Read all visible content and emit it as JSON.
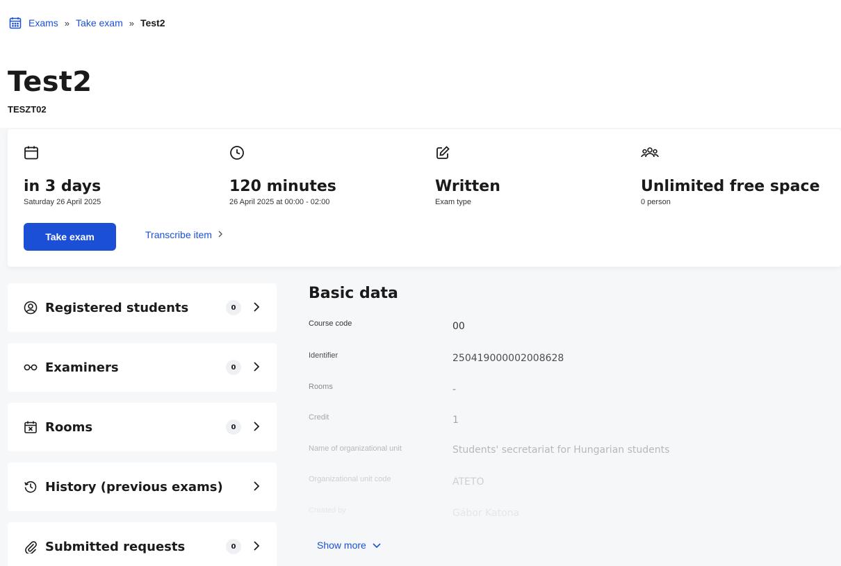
{
  "breadcrumb": {
    "items": [
      "Exams",
      "Take exam"
    ],
    "separator": "»",
    "current": "Test2"
  },
  "exam": {
    "title": "Test2",
    "code": "TESZT02"
  },
  "summary": {
    "date": {
      "icon": "calendar-icon",
      "value": "in 3 days",
      "sub": "Saturday 26 April 2025"
    },
    "duration": {
      "icon": "clock-icon",
      "value": "120 minutes",
      "sub": "26 April 2025 at 00:00 - 02:00"
    },
    "type": {
      "icon": "edit-icon",
      "value": "Written",
      "sub": "Exam type"
    },
    "space": {
      "icon": "group-icon",
      "value": "Unlimited free space",
      "sub": "0 person"
    },
    "take_exam_label": "Take exam",
    "transcribe_label": "Transcribe item"
  },
  "sidebar": {
    "items": [
      {
        "icon": "user-circle-icon",
        "label": "Registered students",
        "count": "0"
      },
      {
        "icon": "glasses-icon",
        "label": "Examiners",
        "count": "0"
      },
      {
        "icon": "room-icon",
        "label": "Rooms",
        "count": "0"
      },
      {
        "icon": "history-icon",
        "label": "History (previous exams)",
        "count": ""
      },
      {
        "icon": "paperclip-icon",
        "label": "Submitted requests",
        "count": "0"
      }
    ]
  },
  "basic_data": {
    "title": "Basic data",
    "fields": [
      {
        "label": "Course code",
        "value": "00"
      },
      {
        "label": "Identifier",
        "value": "250419000002008628"
      },
      {
        "label": "Rooms",
        "value": "-"
      },
      {
        "label": "Credit",
        "value": "1"
      },
      {
        "label": "Name of organizational unit",
        "value": "Students' secretariat for Hungarian students"
      },
      {
        "label": "Organizational unit code",
        "value": "ATETO"
      },
      {
        "label": "Created by",
        "value": "Gábor Katona"
      }
    ],
    "show_more_label": "Show more"
  },
  "colors": {
    "primary": "#1a4fd6",
    "background": "#f6f7f9",
    "card": "#ffffff"
  }
}
